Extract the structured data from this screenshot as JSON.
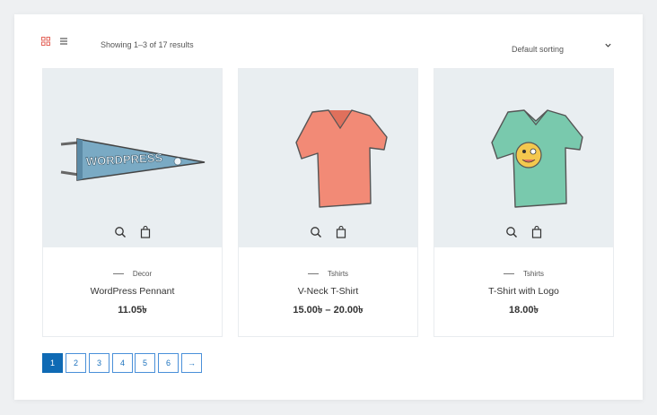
{
  "toolbar": {
    "results_text": "Showing 1–3 of 17 results",
    "sorting_selected": "Default sorting",
    "grid_icon": "grid-view-icon",
    "list_icon": "list-view-icon",
    "accent_color": "#e2574c"
  },
  "products": [
    {
      "category": "Decor",
      "title": "WordPress Pennant",
      "price": "11.05৳",
      "image": "wordpress-pennant-image"
    },
    {
      "category": "Tshirts",
      "title": "V-Neck T-Shirt",
      "price": "15.00৳  – 20.00৳",
      "image": "vneck-tshirt-image"
    },
    {
      "category": "Tshirts",
      "title": "T-Shirt with Logo",
      "price": "18.00৳",
      "image": "tshirt-with-logo-image"
    }
  ],
  "product_actions": [
    "search-icon",
    "shopping-bag-icon"
  ],
  "pennant_text": "WORDPRESS",
  "pagination": {
    "pages": [
      "1",
      "2",
      "3",
      "4",
      "5",
      "6"
    ],
    "current": "1",
    "next": "→",
    "active_color": "#0f6ab4"
  }
}
